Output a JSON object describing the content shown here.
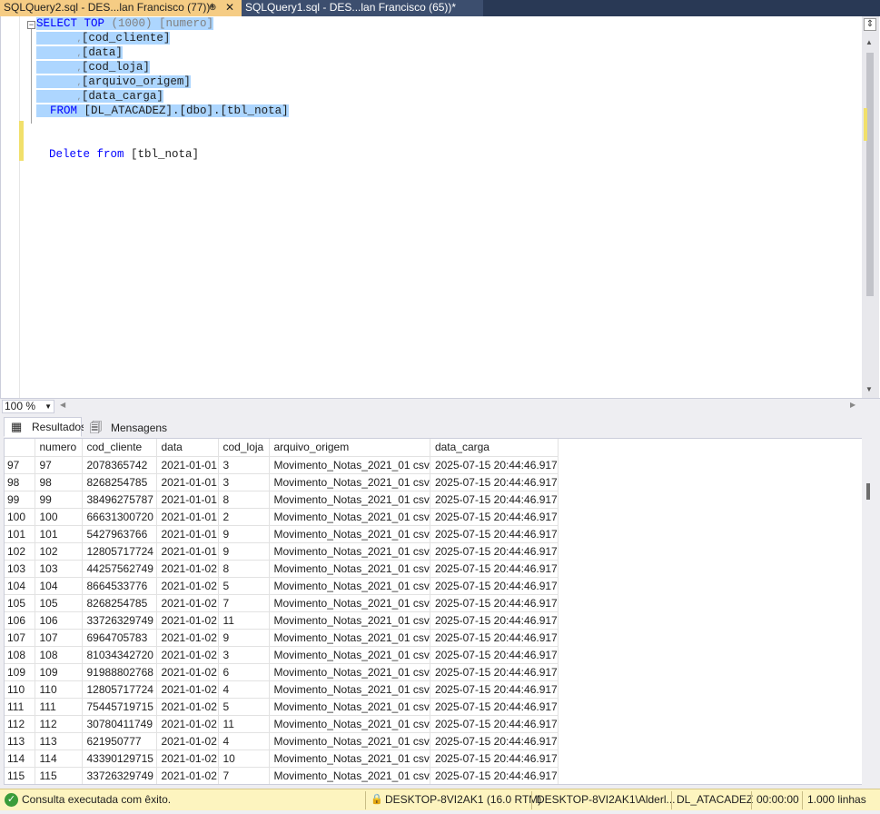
{
  "tabs": [
    {
      "title": "SQLQuery2.sql - DES...lan Francisco (77))*",
      "pin": "⊕",
      "close": "✕"
    },
    {
      "title": "SQLQuery1.sql - DES...lan Francisco (65))*"
    }
  ],
  "editor": {
    "collapse_symbol": "−",
    "lines": {
      "l1_kw": "SELECT TOP",
      "l1_rest": " (1000) [numero]",
      "l2": "[cod_cliente]",
      "l3": "[data]",
      "l4": "[cod_loja]",
      "l5": "[arquivo_origem]",
      "l6": "[data_carga]",
      "l7_kw": "FROM",
      "l7_rest": " [DL_ATACADEZ].[dbo].[tbl_nota]",
      "l10_kw": "Delete from",
      "l10_rest": " [tbl_nota]"
    },
    "comma": ","
  },
  "zoom": {
    "value": "100 %"
  },
  "result_tabs": {
    "results": "Resultados",
    "messages": "Mensagens"
  },
  "grid": {
    "columns": [
      "",
      "numero",
      "cod_cliente",
      "data",
      "cod_loja",
      "arquivo_origem",
      "data_carga"
    ],
    "rows": [
      [
        "97",
        "97",
        "2078365742",
        "2021-01-01",
        "3",
        "Movimento_Notas_2021_01 csv",
        "2025-07-15 20:44:46.917"
      ],
      [
        "98",
        "98",
        "8268254785",
        "2021-01-01",
        "3",
        "Movimento_Notas_2021_01 csv",
        "2025-07-15 20:44:46.917"
      ],
      [
        "99",
        "99",
        "38496275787",
        "2021-01-01",
        "8",
        "Movimento_Notas_2021_01 csv",
        "2025-07-15 20:44:46.917"
      ],
      [
        "100",
        "100",
        "66631300720",
        "2021-01-01",
        "2",
        "Movimento_Notas_2021_01 csv",
        "2025-07-15 20:44:46.917"
      ],
      [
        "101",
        "101",
        "5427963766",
        "2021-01-01",
        "9",
        "Movimento_Notas_2021_01 csv",
        "2025-07-15 20:44:46.917"
      ],
      [
        "102",
        "102",
        "12805717724",
        "2021-01-01",
        "9",
        "Movimento_Notas_2021_01 csv",
        "2025-07-15 20:44:46.917"
      ],
      [
        "103",
        "103",
        "44257562749",
        "2021-01-02",
        "8",
        "Movimento_Notas_2021_01 csv",
        "2025-07-15 20:44:46.917"
      ],
      [
        "104",
        "104",
        "8664533776",
        "2021-01-02",
        "5",
        "Movimento_Notas_2021_01 csv",
        "2025-07-15 20:44:46.917"
      ],
      [
        "105",
        "105",
        "8268254785",
        "2021-01-02",
        "7",
        "Movimento_Notas_2021_01 csv",
        "2025-07-15 20:44:46.917"
      ],
      [
        "106",
        "106",
        "33726329749",
        "2021-01-02",
        "11",
        "Movimento_Notas_2021_01 csv",
        "2025-07-15 20:44:46.917"
      ],
      [
        "107",
        "107",
        "6964705783",
        "2021-01-02",
        "9",
        "Movimento_Notas_2021_01 csv",
        "2025-07-15 20:44:46.917"
      ],
      [
        "108",
        "108",
        "81034342720",
        "2021-01-02",
        "3",
        "Movimento_Notas_2021_01 csv",
        "2025-07-15 20:44:46.917"
      ],
      [
        "109",
        "109",
        "91988802768",
        "2021-01-02",
        "6",
        "Movimento_Notas_2021_01 csv",
        "2025-07-15 20:44:46.917"
      ],
      [
        "110",
        "110",
        "12805717724",
        "2021-01-02",
        "4",
        "Movimento_Notas_2021_01 csv",
        "2025-07-15 20:44:46.917"
      ],
      [
        "111",
        "111",
        "75445719715",
        "2021-01-02",
        "5",
        "Movimento_Notas_2021_01 csv",
        "2025-07-15 20:44:46.917"
      ],
      [
        "112",
        "112",
        "30780411749",
        "2021-01-02",
        "11",
        "Movimento_Notas_2021_01 csv",
        "2025-07-15 20:44:46.917"
      ],
      [
        "113",
        "113",
        "621950777",
        "2021-01-02",
        "4",
        "Movimento_Notas_2021_01 csv",
        "2025-07-15 20:44:46.917"
      ],
      [
        "114",
        "114",
        "43390129715",
        "2021-01-02",
        "10",
        "Movimento_Notas_2021_01 csv",
        "2025-07-15 20:44:46.917"
      ],
      [
        "115",
        "115",
        "33726329749",
        "2021-01-02",
        "7",
        "Movimento_Notas_2021_01 csv",
        "2025-07-15 20:44:46.917"
      ]
    ]
  },
  "status": {
    "message": "Consulta executada com êxito.",
    "server": "DESKTOP-8VI2AK1 (16.0 RTM)",
    "user": "DESKTOP-8VI2AK1\\Alderl...",
    "database": "DL_ATACADEZ",
    "time": "00:00:00",
    "rows": "1.000 linhas"
  }
}
